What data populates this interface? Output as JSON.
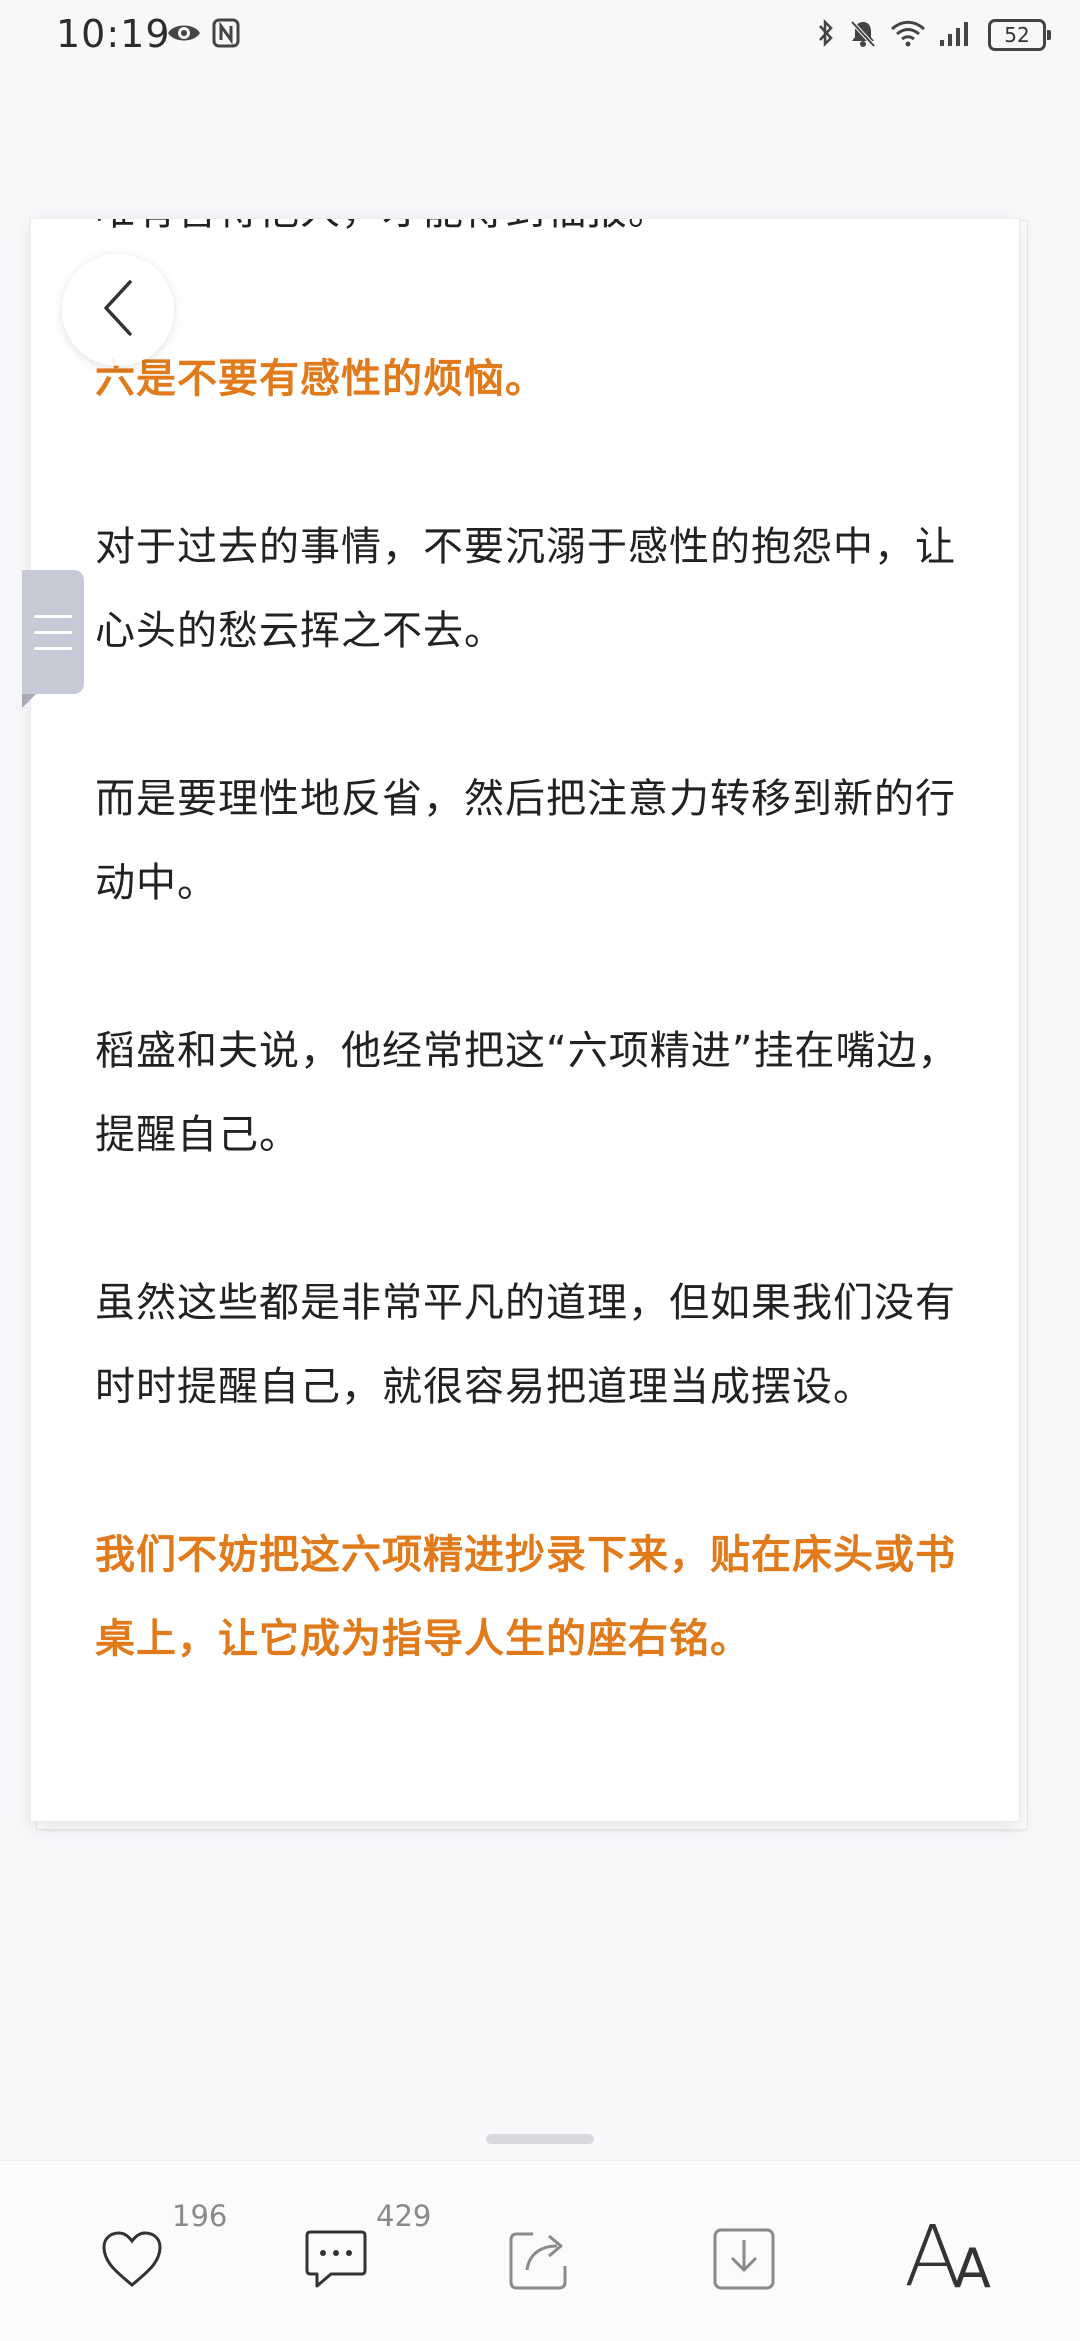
{
  "status_bar": {
    "time": "10:19",
    "battery": "52"
  },
  "article": {
    "partial_line": "唯有善待他人，才能得到福报。",
    "paragraphs": [
      {
        "text": "六是不要有感性的烦恼。",
        "highlight": true
      },
      {
        "text": "对于过去的事情，不要沉溺于感性的抱怨中，让心头的愁云挥之不去。",
        "highlight": false
      },
      {
        "text": "而是要理性地反省，然后把注意力转移到新的行动中。",
        "highlight": false
      },
      {
        "text": "稻盛和夫说，他经常把这“六项精进”挂在嘴边，提醒自己。",
        "highlight": false
      },
      {
        "text": "虽然这些都是非常平凡的道理，但如果我们没有时时提醒自己，就很容易把道理当成摆设。",
        "highlight": false
      },
      {
        "text": "我们不妨把这六项精进抄录下来，贴在床头或书桌上，让它成为指导人生的座右铭。",
        "highlight": true
      }
    ]
  },
  "bottom_bar": {
    "like_count": "196",
    "comment_count": "429",
    "font_big": "A",
    "font_small": "A"
  },
  "colors": {
    "highlight": "#e07a1a",
    "text": "#222222",
    "side_tab": "#c7c9d6"
  }
}
